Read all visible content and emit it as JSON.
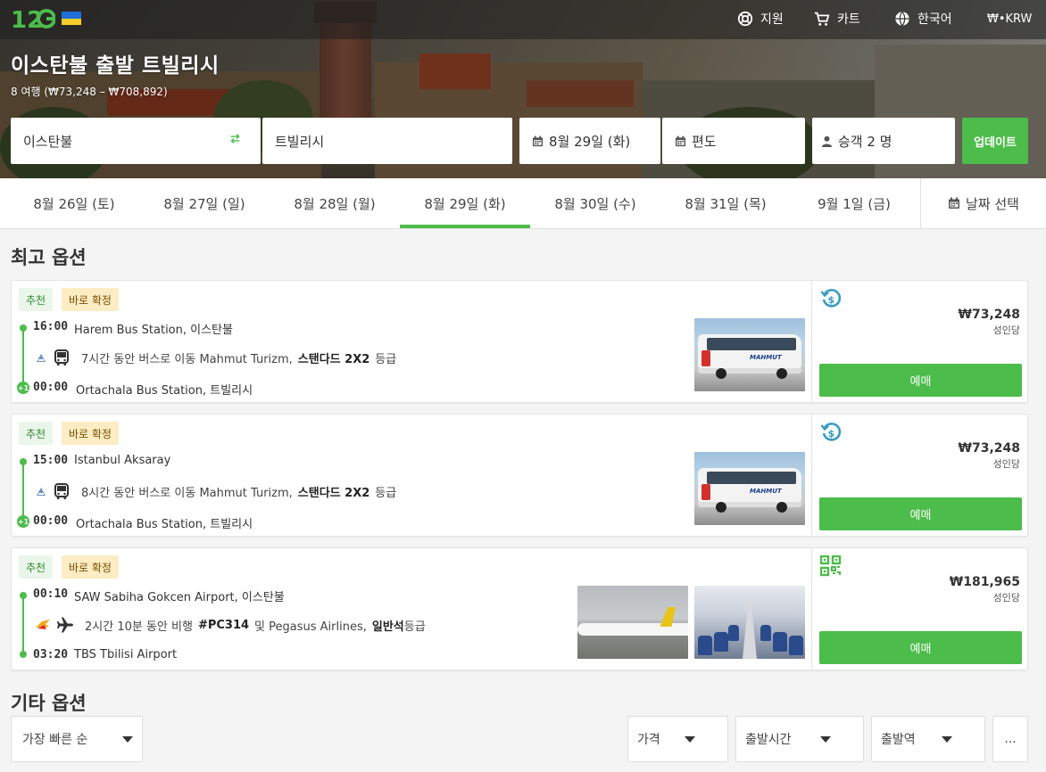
{
  "header": {
    "nav": [
      {
        "label": "지원",
        "icon": "lifebuoy-icon"
      },
      {
        "label": "카트",
        "icon": "cart-icon"
      },
      {
        "label": "한국어",
        "icon": "globe-icon"
      },
      {
        "label": "₩•KRW",
        "icon": ""
      }
    ]
  },
  "hero": {
    "title": "이스탄불 출발 트빌리시",
    "subtitle": "8 여행 (₩73,248 – ₩708,892)"
  },
  "search": {
    "from": "이스탄불",
    "to": "트빌리시",
    "date": "8월 29일 (화)",
    "return": "편도",
    "passengers": "승객 2 명",
    "update": "업데이트"
  },
  "dates": {
    "tabs": [
      "8월 26일 (토)",
      "8월 27일 (일)",
      "8월 28일 (월)",
      "8월 29일 (화)",
      "8월 30일 (수)",
      "8월 31일 (목)",
      "9월 1일 (금)"
    ],
    "active_index": 3,
    "picker": "날짜 선택"
  },
  "best": {
    "title": "최고 옵션",
    "cards": [
      {
        "badges": [
          "추천",
          "바로 확정"
        ],
        "dep_time": "16:00",
        "dep_station": "Harem Bus Station, 이스탄불",
        "duration": "7시간 동안 버스로 이동 Mahmut Turizm,",
        "class_bold": "스탠다드 2X2",
        "class_suffix": "등급",
        "arr_time": "00:00",
        "arr_station": "Ortachala Bus Station, 트빌리시",
        "price": "₩73,248",
        "per": "성인당",
        "book": "예매",
        "type": "bus",
        "arr_plus": "+1"
      },
      {
        "badges": [
          "추천",
          "바로 확정"
        ],
        "dep_time": "15:00",
        "dep_station": "Istanbul Aksaray",
        "duration": "8시간 동안 버스로 이동 Mahmut Turizm,",
        "class_bold": "스탠다드 2X2",
        "class_suffix": "등급",
        "arr_time": "00:00",
        "arr_station": "Ortachala Bus Station, 트빌리시",
        "price": "₩73,248",
        "per": "성인당",
        "book": "예매",
        "type": "bus",
        "arr_plus": "+1"
      },
      {
        "badges": [
          "추천",
          "바로 확정"
        ],
        "dep_time": "00:10",
        "dep_station": "SAW Sabiha Gokcen Airport, 이스탄불",
        "duration": "2시간 10분 동안 비행",
        "flight_no": "#PC314",
        "flight_mid": "및 Pegasus Airlines,",
        "class_bold": "일반석",
        "class_suffix": "등급",
        "arr_time": "03:20",
        "arr_station": "TBS Tbilisi Airport",
        "price": "₩181,965",
        "per": "성인당",
        "book": "예매",
        "type": "plane"
      }
    ]
  },
  "other": {
    "title": "기타 옵션",
    "sort": "가장 빠른 순",
    "filters": [
      "가격",
      "출발시간",
      "출발역"
    ],
    "more": "..."
  },
  "colors": {
    "accent": "#4cbc4a",
    "refund_icon": "#3a9bc4"
  }
}
